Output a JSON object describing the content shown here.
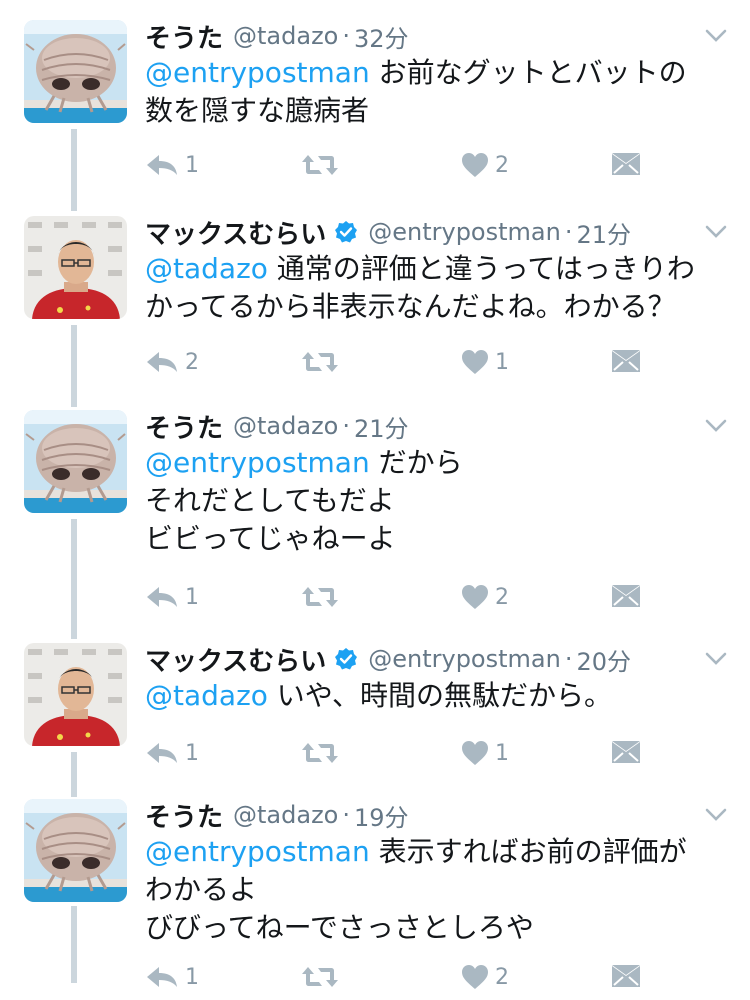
{
  "tweets": [
    {
      "name": "そうた",
      "handle": "@tadazo",
      "time": "32分",
      "verified": false,
      "lines": [
        {
          "mention": "@entrypostman",
          "text": " お前なグットとバットの"
        },
        {
          "mention": "",
          "text": "数を隠すな臆病者"
        }
      ],
      "reply_count": "1",
      "retweet_count": "",
      "like_count": "2"
    },
    {
      "name": "マックスむらい",
      "handle": "@entrypostman",
      "time": "21分",
      "verified": true,
      "lines": [
        {
          "mention": "@tadazo",
          "text": " 通常の評価と違うってはっきりわ"
        },
        {
          "mention": "",
          "text": "かってるから非表示なんだよね。わかる？"
        }
      ],
      "reply_count": "2",
      "retweet_count": "",
      "like_count": "1"
    },
    {
      "name": "そうた",
      "handle": "@tadazo",
      "time": "21分",
      "verified": false,
      "lines": [
        {
          "mention": "@entrypostman",
          "text": " だから"
        },
        {
          "mention": "",
          "text": "それだとしてもだよ"
        },
        {
          "mention": "",
          "text": "ビビってじゃねーよ"
        }
      ],
      "reply_count": "1",
      "retweet_count": "",
      "like_count": "2"
    },
    {
      "name": "マックスむらい",
      "handle": "@entrypostman",
      "time": "20分",
      "verified": true,
      "lines": [
        {
          "mention": "@tadazo",
          "text": " いや、時間の無駄だから。"
        }
      ],
      "reply_count": "1",
      "retweet_count": "",
      "like_count": "1"
    },
    {
      "name": "そうた",
      "handle": "@tadazo",
      "time": "19分",
      "verified": false,
      "lines": [
        {
          "mention": "@entrypostman",
          "text": " 表示すればお前の評価が"
        },
        {
          "mention": "",
          "text": "わかるよ"
        },
        {
          "mention": "",
          "text": "びびってねーでさっさとしろや"
        }
      ],
      "reply_count": "1",
      "retweet_count": "",
      "like_count": "2"
    }
  ],
  "icons": {
    "reply": "reply-icon",
    "retweet": "retweet-icon",
    "like": "heart-icon",
    "dm": "direct-message-icon",
    "more": "chevron-down-icon",
    "verified": "verified-badge-icon"
  },
  "colors": {
    "mention": "#1da1f2",
    "meta": "#657786",
    "action": "#aab8c2",
    "verified": "#1da1f2",
    "thread_line": "#ccd6dd"
  }
}
